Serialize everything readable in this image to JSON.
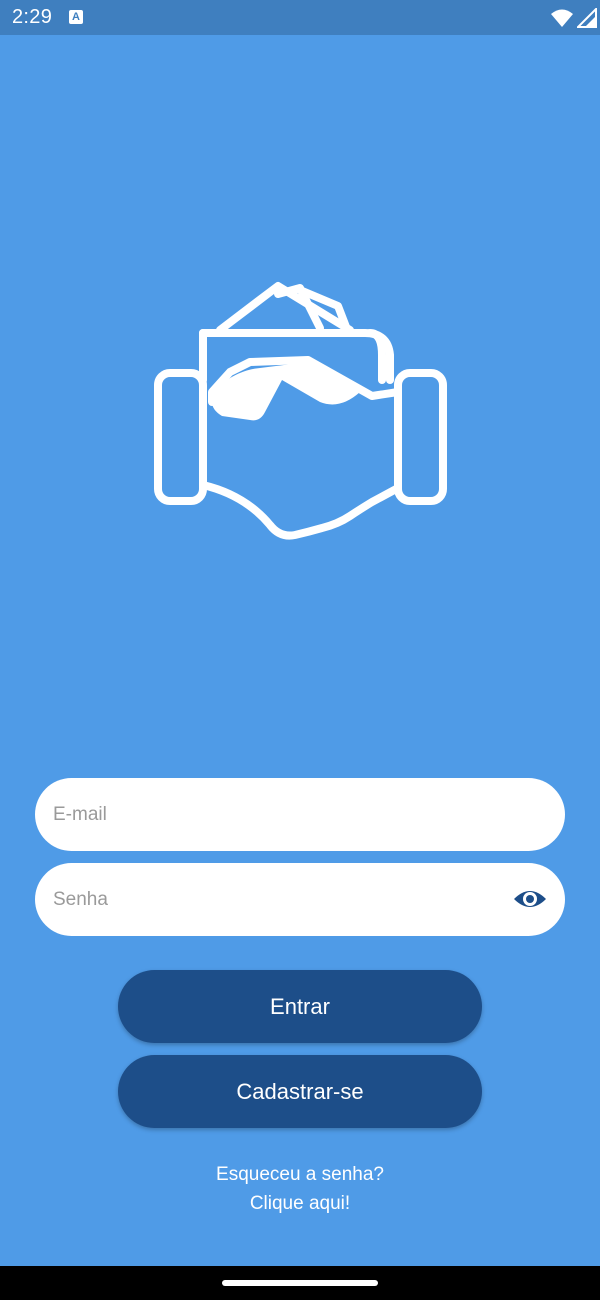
{
  "status_bar": {
    "time": "2:29",
    "app_icon_letter": "A",
    "icons": [
      "wifi-icon",
      "signal-icon",
      "battery-icon"
    ]
  },
  "logo": {
    "icon": "handshake-money-icon"
  },
  "form": {
    "email_placeholder": "E-mail",
    "email_value": "",
    "password_placeholder": "Senha",
    "password_value": "",
    "password_toggle_icon": "eye-icon"
  },
  "buttons": {
    "login_label": "Entrar",
    "signup_label": "Cadastrar-se"
  },
  "forgot": {
    "question": "Esqueceu a senha?",
    "link": "Clique aqui!"
  },
  "colors": {
    "background": "#4f9be7",
    "status_bar": "#3f7fbf",
    "button": "#1d4e89",
    "field": "#ffffff"
  }
}
